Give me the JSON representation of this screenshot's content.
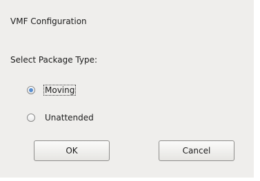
{
  "dialog": {
    "title": "VMF Configuration",
    "prompt": "Select Package Type:",
    "options": [
      {
        "label": "Moving",
        "selected": true
      },
      {
        "label": "Unattended",
        "selected": false
      }
    ],
    "buttons": {
      "ok_label": "OK",
      "cancel_label": "Cancel"
    }
  }
}
